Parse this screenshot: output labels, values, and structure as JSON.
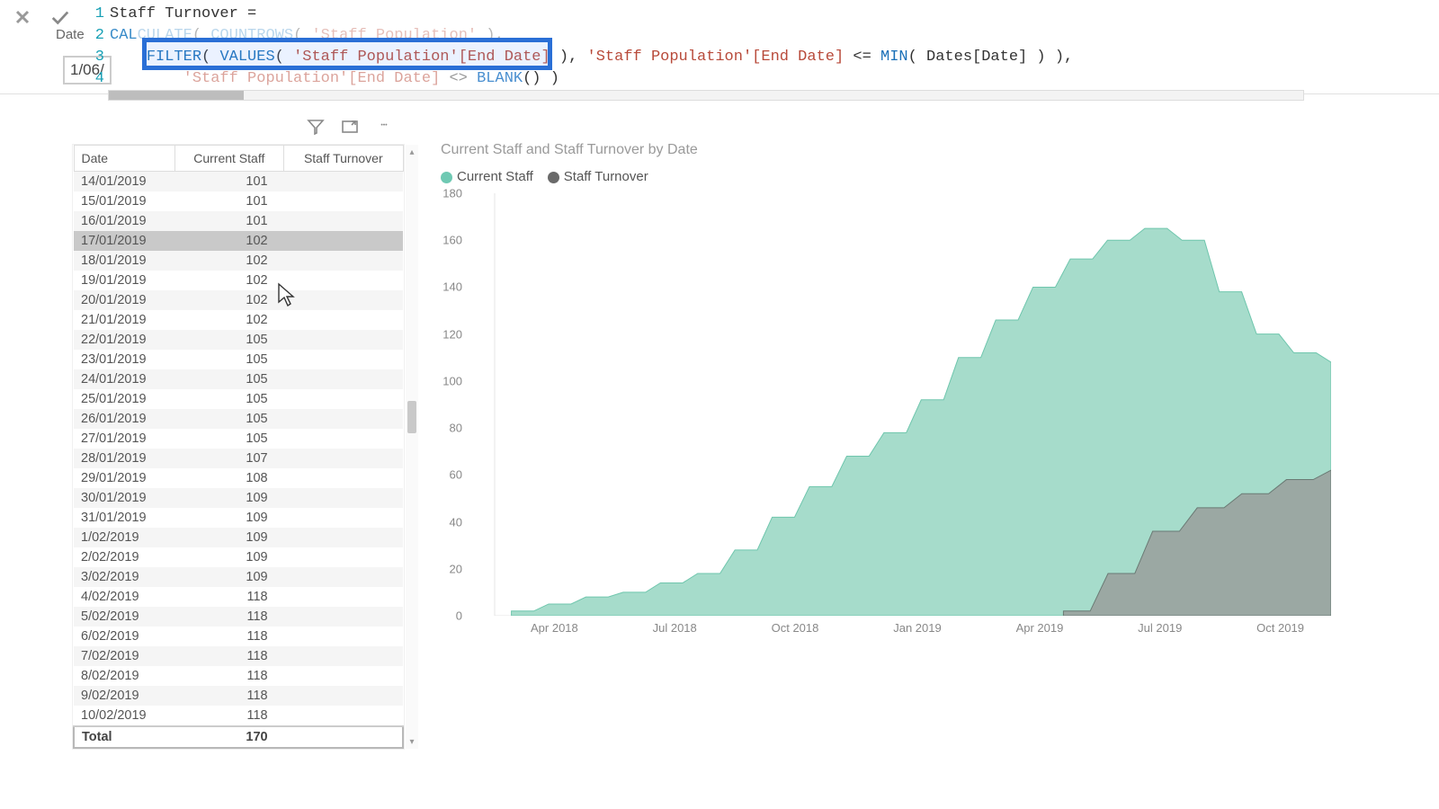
{
  "formula": {
    "measure_name": "Staff Turnover =",
    "lines": {
      "2a": "CAL",
      "2b": "CULATE",
      "2c": "( ",
      "2d": "COUNTROWS",
      "2e": "( ",
      "2f": "'Staff Population'",
      "2g": " ),",
      "3a": "FILTER",
      "3b": "( ",
      "3c": "VALUES",
      "3d": "( ",
      "3e": "'Staff Population'[End Date]",
      "3f": " ),",
      "3g": " ",
      "3h": "'Staff Population'[End Date]",
      "3i": " <= ",
      "3j": "MIN",
      "3k": "( Dates[Date] ) ),",
      "4a": "'Staff Population'[End Date]",
      "4b": " <> ",
      "4c": "BLANK",
      "4d": "() )"
    }
  },
  "peek": {
    "label": "Date",
    "value": "1/06/"
  },
  "table": {
    "headers": {
      "date": "Date",
      "current": "Current Staff",
      "turnover": "Staff Turnover"
    },
    "rows": [
      {
        "date": "14/01/2019",
        "current": "101",
        "turnover": ""
      },
      {
        "date": "15/01/2019",
        "current": "101",
        "turnover": ""
      },
      {
        "date": "16/01/2019",
        "current": "101",
        "turnover": ""
      },
      {
        "date": "17/01/2019",
        "current": "102",
        "turnover": ""
      },
      {
        "date": "18/01/2019",
        "current": "102",
        "turnover": ""
      },
      {
        "date": "19/01/2019",
        "current": "102",
        "turnover": ""
      },
      {
        "date": "20/01/2019",
        "current": "102",
        "turnover": ""
      },
      {
        "date": "21/01/2019",
        "current": "102",
        "turnover": ""
      },
      {
        "date": "22/01/2019",
        "current": "105",
        "turnover": ""
      },
      {
        "date": "23/01/2019",
        "current": "105",
        "turnover": ""
      },
      {
        "date": "24/01/2019",
        "current": "105",
        "turnover": ""
      },
      {
        "date": "25/01/2019",
        "current": "105",
        "turnover": ""
      },
      {
        "date": "26/01/2019",
        "current": "105",
        "turnover": ""
      },
      {
        "date": "27/01/2019",
        "current": "105",
        "turnover": ""
      },
      {
        "date": "28/01/2019",
        "current": "107",
        "turnover": ""
      },
      {
        "date": "29/01/2019",
        "current": "108",
        "turnover": ""
      },
      {
        "date": "30/01/2019",
        "current": "109",
        "turnover": ""
      },
      {
        "date": "31/01/2019",
        "current": "109",
        "turnover": ""
      },
      {
        "date": "1/02/2019",
        "current": "109",
        "turnover": ""
      },
      {
        "date": "2/02/2019",
        "current": "109",
        "turnover": ""
      },
      {
        "date": "3/02/2019",
        "current": "109",
        "turnover": ""
      },
      {
        "date": "4/02/2019",
        "current": "118",
        "turnover": ""
      },
      {
        "date": "5/02/2019",
        "current": "118",
        "turnover": ""
      },
      {
        "date": "6/02/2019",
        "current": "118",
        "turnover": ""
      },
      {
        "date": "7/02/2019",
        "current": "118",
        "turnover": ""
      },
      {
        "date": "8/02/2019",
        "current": "118",
        "turnover": ""
      },
      {
        "date": "9/02/2019",
        "current": "118",
        "turnover": ""
      },
      {
        "date": "10/02/2019",
        "current": "118",
        "turnover": ""
      }
    ],
    "selected_index": 3,
    "total_label": "Total",
    "total_current": "170"
  },
  "chart_data": {
    "type": "area",
    "title": "Current Staff and Staff Turnover by Date",
    "xlabel": "",
    "ylabel": "",
    "y_ticks": [
      0,
      20,
      40,
      60,
      80,
      100,
      120,
      140,
      160,
      180
    ],
    "x_ticks": [
      "Apr 2018",
      "Jul 2018",
      "Oct 2018",
      "Jan 2019",
      "Apr 2019",
      "Jul 2019",
      "Oct 2019"
    ],
    "series": [
      {
        "name": "Current Staff",
        "color": "#6fc9b3",
        "x": [
          "Feb 2018",
          "Mar 2018",
          "Apr 2018",
          "May 2018",
          "Jun 2018",
          "Jul 2018",
          "Aug 2018",
          "Sep 2018",
          "Oct 2018",
          "Nov 2018",
          "Dec 2018",
          "Jan 2019",
          "Feb 2019",
          "Mar 2019",
          "Apr 2019",
          "May 2019",
          "Jun 2019",
          "Jul 2019",
          "Aug 2019",
          "Sep 2019",
          "Oct 2019",
          "Nov 2019",
          "Dec 2019"
        ],
        "values": [
          2,
          5,
          8,
          10,
          14,
          18,
          28,
          42,
          55,
          68,
          78,
          92,
          110,
          126,
          140,
          152,
          160,
          165,
          160,
          138,
          120,
          112,
          108
        ]
      },
      {
        "name": "Staff Turnover",
        "color": "#6a6a6a",
        "x": [
          "Jun 2019",
          "Jul 2019",
          "Aug 2019",
          "Sep 2019",
          "Oct 2019",
          "Nov 2019",
          "Dec 2019"
        ],
        "values": [
          2,
          18,
          36,
          46,
          52,
          58,
          62
        ]
      }
    ]
  }
}
